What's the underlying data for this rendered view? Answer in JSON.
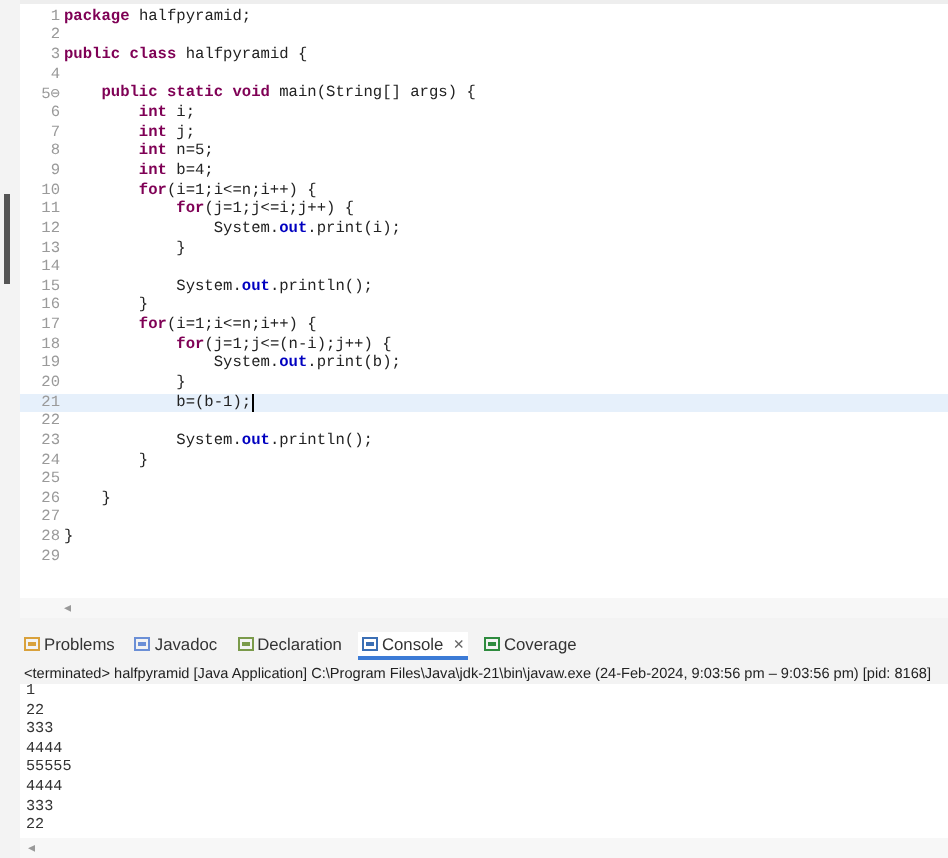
{
  "editor": {
    "lines": [
      {
        "number": "1",
        "current": false,
        "segments": [
          {
            "kind": "keyword",
            "text": "package"
          },
          {
            "kind": "plain",
            "text": " halfpyramid;"
          }
        ]
      },
      {
        "number": "2",
        "current": false
      },
      {
        "number": "3",
        "current": false,
        "segments": [
          {
            "kind": "keyword",
            "text": "public class"
          },
          {
            "kind": "plain",
            "text": " halfpyramid {"
          }
        ]
      },
      {
        "number": "4",
        "current": false
      },
      {
        "number": "5",
        "fold": "⊖",
        "current": false,
        "segments": [
          {
            "kind": "keyword",
            "text": "    public static void"
          },
          {
            "kind": "plain",
            "text": " main(String[] args) {"
          }
        ]
      },
      {
        "number": "6",
        "current": false,
        "segments": [
          {
            "kind": "keyword",
            "text": "        int"
          },
          {
            "kind": "plain",
            "text": " i;"
          }
        ]
      },
      {
        "number": "7",
        "current": false,
        "segments": [
          {
            "kind": "keyword",
            "text": "        int"
          },
          {
            "kind": "plain",
            "text": " j;"
          }
        ]
      },
      {
        "number": "8",
        "current": false,
        "segments": [
          {
            "kind": "keyword",
            "text": "        int"
          },
          {
            "kind": "plain",
            "text": " n=5;"
          }
        ]
      },
      {
        "number": "9",
        "current": false,
        "segments": [
          {
            "kind": "keyword",
            "text": "        int"
          },
          {
            "kind": "plain",
            "text": " b=4;"
          }
        ]
      },
      {
        "number": "10",
        "current": false,
        "segments": [
          {
            "kind": "keyword",
            "text": "        for"
          },
          {
            "kind": "plain",
            "text": "(i=1;i<=n;i++) {"
          }
        ]
      },
      {
        "number": "11",
        "current": false,
        "segments": [
          {
            "kind": "keyword",
            "text": "            for"
          },
          {
            "kind": "plain",
            "text": "(j=1;j<=i;j++) {"
          }
        ]
      },
      {
        "number": "12",
        "current": false,
        "segments": [
          {
            "kind": "plain",
            "text": "                System."
          },
          {
            "kind": "field",
            "text": "out"
          },
          {
            "kind": "plain",
            "text": ".print(i);"
          }
        ]
      },
      {
        "number": "13",
        "current": false,
        "segments": [
          {
            "kind": "plain",
            "text": "            }"
          }
        ]
      },
      {
        "number": "14",
        "current": false
      },
      {
        "number": "15",
        "current": false,
        "segments": [
          {
            "kind": "plain",
            "text": "            System."
          },
          {
            "kind": "field",
            "text": "out"
          },
          {
            "kind": "plain",
            "text": ".println();"
          }
        ]
      },
      {
        "number": "16",
        "current": false,
        "segments": [
          {
            "kind": "plain",
            "text": "        }"
          }
        ]
      },
      {
        "number": "17",
        "current": false,
        "segments": [
          {
            "kind": "keyword",
            "text": "        for"
          },
          {
            "kind": "plain",
            "text": "(i=1;i<=n;i++) {"
          }
        ]
      },
      {
        "number": "18",
        "current": false,
        "segments": [
          {
            "kind": "keyword",
            "text": "            for"
          },
          {
            "kind": "plain",
            "text": "(j=1;j<=(n-i);j++) {"
          }
        ]
      },
      {
        "number": "19",
        "current": false,
        "segments": [
          {
            "kind": "plain",
            "text": "                System."
          },
          {
            "kind": "field",
            "text": "out"
          },
          {
            "kind": "plain",
            "text": ".print(b);"
          }
        ]
      },
      {
        "number": "20",
        "current": false,
        "segments": [
          {
            "kind": "plain",
            "text": "            }"
          }
        ]
      },
      {
        "number": "21",
        "current": true,
        "segments": [
          {
            "kind": "plain",
            "text": "            b=(b-1);"
          }
        ]
      },
      {
        "number": "22",
        "current": false
      },
      {
        "number": "23",
        "current": false,
        "segments": [
          {
            "kind": "plain",
            "text": "            System."
          },
          {
            "kind": "field",
            "text": "out"
          },
          {
            "kind": "plain",
            "text": ".println();"
          }
        ]
      },
      {
        "number": "24",
        "current": false,
        "segments": [
          {
            "kind": "plain",
            "text": "        }"
          }
        ]
      },
      {
        "number": "25",
        "current": false
      },
      {
        "number": "26",
        "current": false,
        "segments": [
          {
            "kind": "plain",
            "text": "    }"
          }
        ]
      },
      {
        "number": "27",
        "current": false
      },
      {
        "number": "28",
        "current": false,
        "segments": [
          {
            "kind": "plain",
            "text": "}"
          }
        ]
      },
      {
        "number": "29",
        "current": false
      }
    ],
    "scroll_arrow": "◂"
  },
  "panel": {
    "tabs": [
      {
        "label": "Problems",
        "kind": "problems",
        "selected": false
      },
      {
        "label": "Javadoc",
        "kind": "javadoc",
        "selected": false
      },
      {
        "label": "Declaration",
        "kind": "declaration",
        "selected": false
      },
      {
        "label": "Console",
        "kind": "console",
        "selected": true,
        "close": "×"
      },
      {
        "label": "Coverage",
        "kind": "coverage",
        "selected": false
      }
    ],
    "console_header": "<terminated> halfpyramid [Java Application] C:\\Program Files\\Java\\jdk-21\\bin\\javaw.exe  (24-Feb-2024, 9:03:56 pm – 9:03:56 pm) [pid: 8168]",
    "output": [
      "1",
      "22",
      "333",
      "4444",
      "55555",
      "4444",
      "333",
      "22"
    ],
    "scroll_arrow": "◂"
  }
}
